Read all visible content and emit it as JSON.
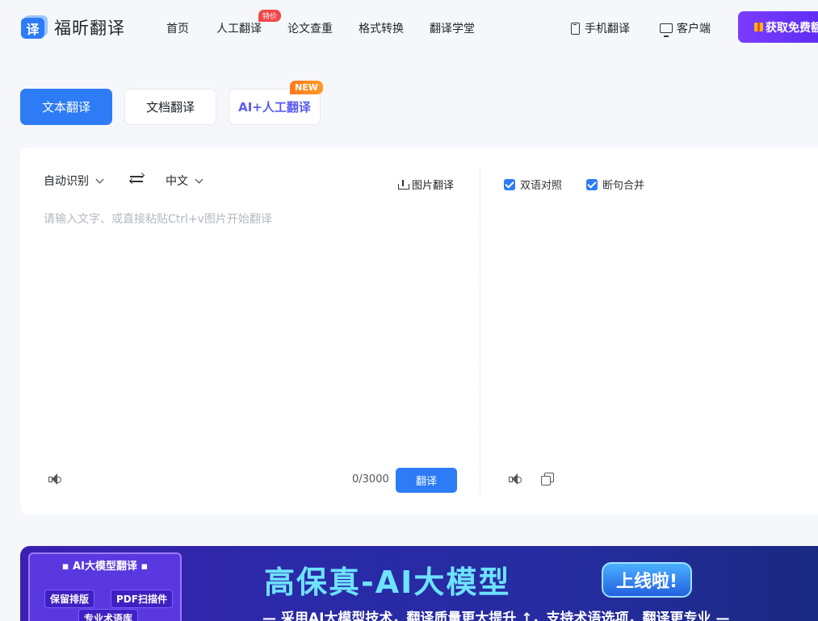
{
  "header": {
    "logo_glyph": "译",
    "logo_text": "福昕翻译",
    "nav": [
      {
        "label": "首页"
      },
      {
        "label": "人工翻译",
        "badge": "特价"
      },
      {
        "label": "论文查重"
      },
      {
        "label": "格式转换"
      },
      {
        "label": "翻译学堂"
      }
    ],
    "mobile_label": "手机翻译",
    "client_label": "客户端",
    "cta_label": "获取免费额"
  },
  "modes": {
    "text": "文本翻译",
    "doc": "文档翻译",
    "ai": "AI+人工翻译",
    "ai_badge": "NEW"
  },
  "translator": {
    "source_lang": "自动识别",
    "target_lang": "中文",
    "image_translate": "图片翻译",
    "placeholder": "请输入文字、或直接粘贴Ctrl+v图片开始翻译",
    "counter": "0/3000",
    "translate_button": "翻译",
    "bilingual_label": "双语对照",
    "merge_label": "断句合并"
  },
  "banner": {
    "card_title": "▪ AI大模型翻译 ▪",
    "features": [
      "保留排版",
      "PDF扫描件",
      "专业术语库"
    ],
    "headline": "高保真-AI大模型",
    "pill": "上线啦!",
    "subline": "— 采用AI大模型技术，翻译质量更大提升 ↑，支持术语选项，翻译更专业 —"
  },
  "colors": {
    "primary": "#2d7cf6",
    "cta": "#6a34f8",
    "hot_badge": "#f04848",
    "new_badge": "#ff8a1f"
  }
}
